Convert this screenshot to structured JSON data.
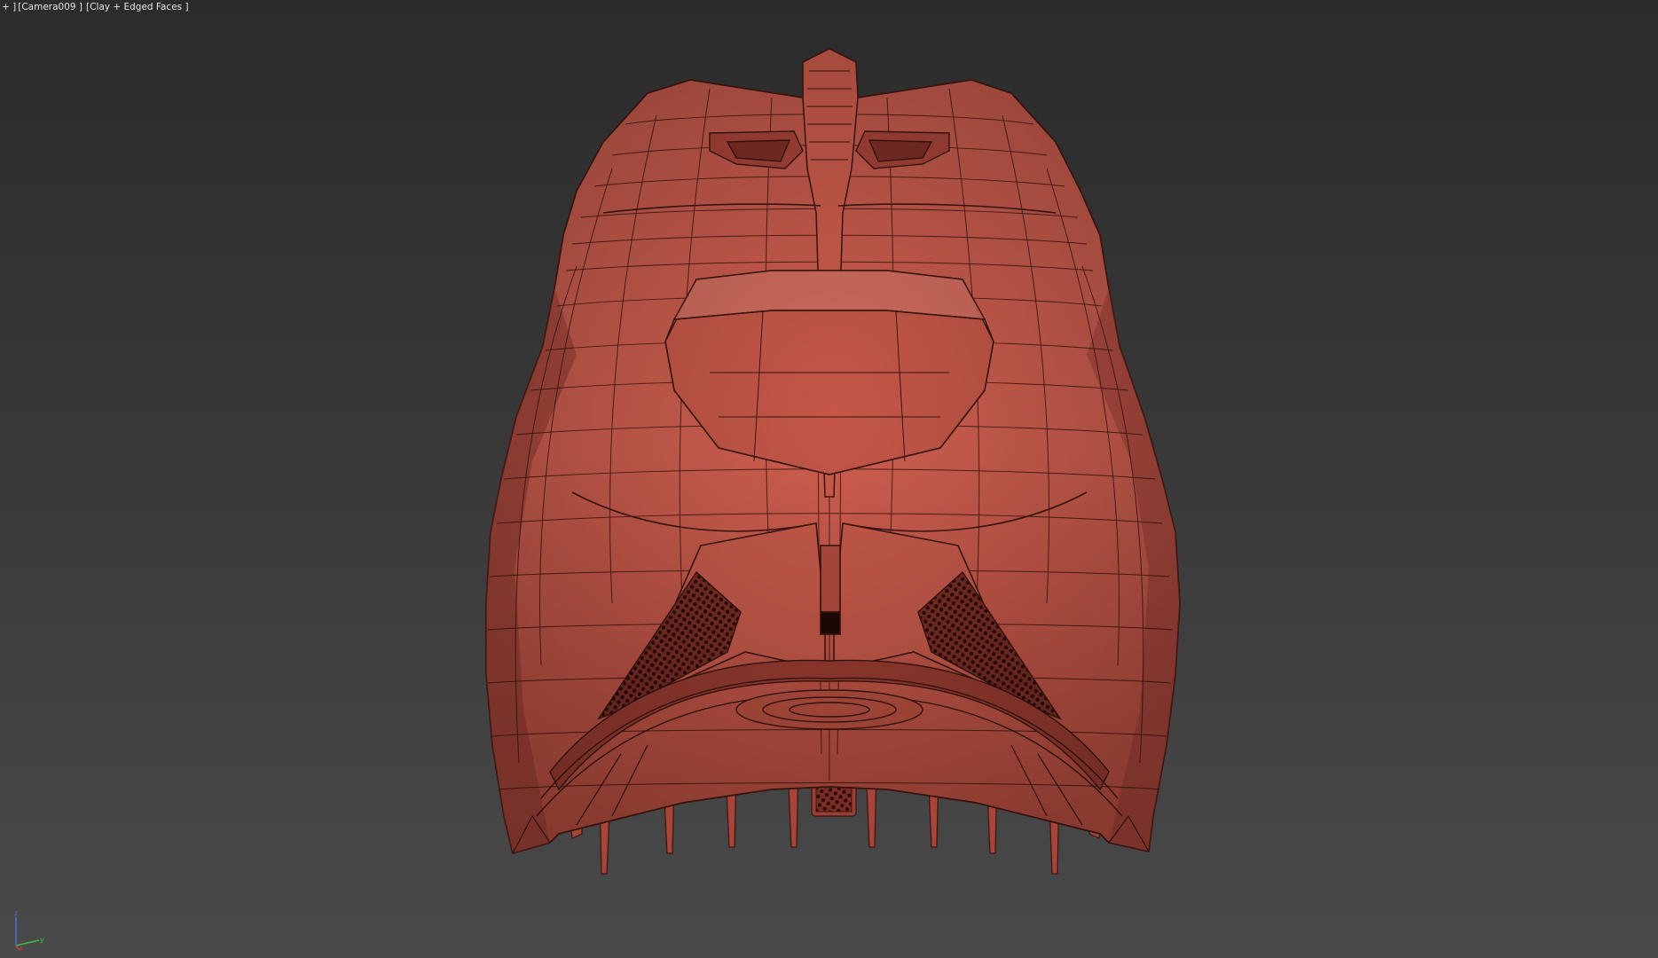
{
  "viewport": {
    "menu_prefix": "+ ]",
    "camera_label": "[Camera009 ]",
    "shading_label": "[Clay + Edged Faces ]"
  },
  "colors": {
    "clay": "#c85a4a",
    "clay_dark": "#8a3328",
    "wire": "#3a1510",
    "background_top": "#2b2b2b",
    "background_bottom": "#4a4a4a"
  },
  "axis_gizmo": {
    "axes": [
      "z",
      "x",
      "y"
    ],
    "colors": {
      "x": "#d23b3b",
      "y": "#3bbf3b",
      "z": "#4a6fd8"
    }
  }
}
